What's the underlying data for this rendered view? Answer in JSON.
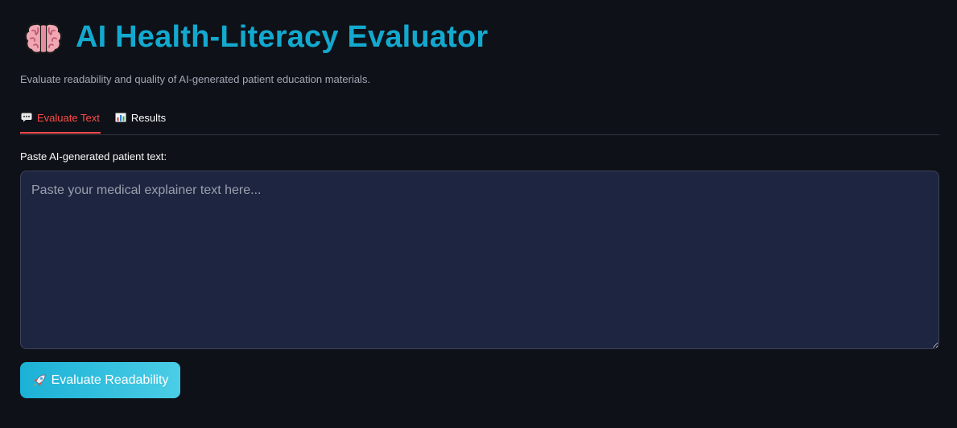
{
  "header": {
    "title": "AI Health-Literacy Evaluator",
    "title_icon": "brain-icon",
    "subtitle": "Evaluate readability and quality of AI-generated patient education materials."
  },
  "tabs": [
    {
      "label": "Evaluate Text",
      "icon": "speech-balloon-icon",
      "active": true
    },
    {
      "label": "Results",
      "icon": "bar-chart-icon",
      "active": false
    }
  ],
  "form": {
    "label": "Paste AI-generated patient text:",
    "placeholder": "Paste your medical explainer text here...",
    "value": ""
  },
  "button": {
    "label": "Evaluate Readability",
    "icon": "rocket-icon"
  },
  "colors": {
    "background": "#0e1117",
    "accent": "#13a9cf",
    "active_tab": "#ff4b4b",
    "input_background": "#1e2540"
  }
}
